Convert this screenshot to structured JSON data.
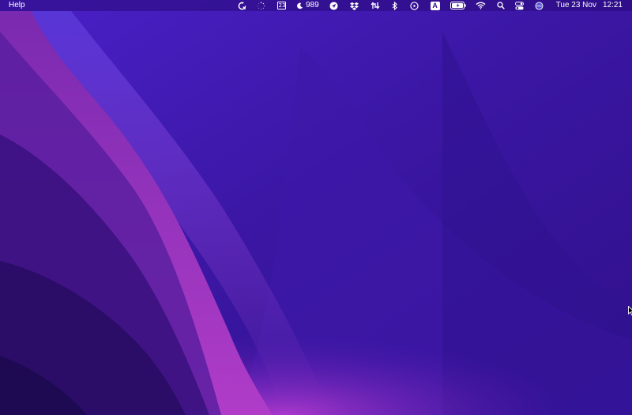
{
  "menubar": {
    "left_menus": [
      {
        "label": "Help"
      }
    ],
    "status_items": [
      {
        "name": "sync-icon"
      },
      {
        "name": "spinner-icon"
      },
      {
        "name": "calendar-icon",
        "text": "23"
      },
      {
        "name": "moon-icon",
        "text": "989"
      },
      {
        "name": "location-arrow-icon"
      },
      {
        "name": "dropbox-icon"
      },
      {
        "name": "network-activity-icon"
      },
      {
        "name": "bluetooth-icon"
      },
      {
        "name": "play-circle-icon"
      },
      {
        "name": "input-source-icon",
        "text": "A"
      },
      {
        "name": "battery-icon"
      },
      {
        "name": "wifi-icon"
      },
      {
        "name": "search-icon"
      },
      {
        "name": "control-center-icon"
      },
      {
        "name": "siri-icon"
      }
    ],
    "clock": {
      "date": "Tue 23 Nov",
      "time": "12:21"
    }
  },
  "colors": {
    "wallpaper_base": "#3a1596",
    "wallpaper_accent": "#8a2fb8",
    "wallpaper_deep": "#1e0a52"
  }
}
